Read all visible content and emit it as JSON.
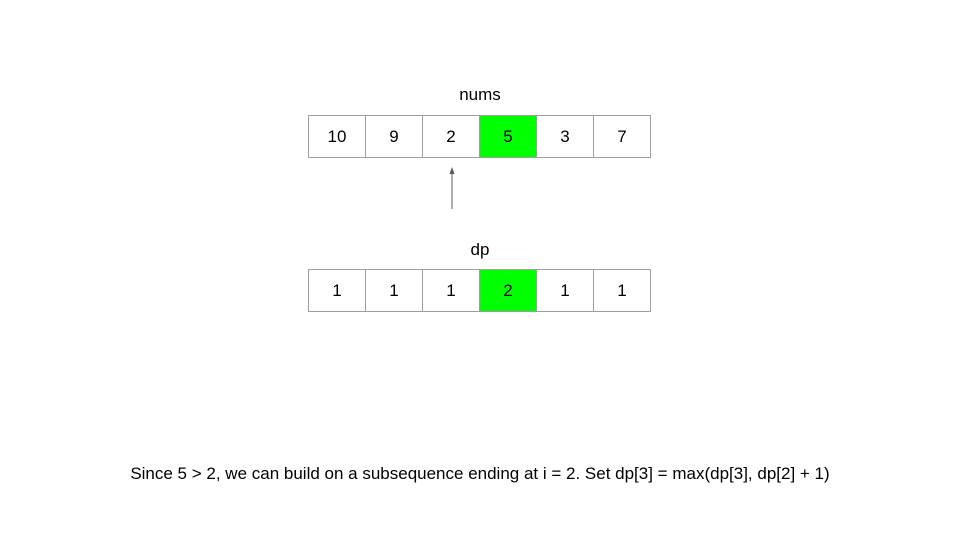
{
  "nums": {
    "title": "nums",
    "values": [
      "10",
      "9",
      "2",
      "5",
      "3",
      "7"
    ],
    "highlight_index": 3,
    "pointer_index": 2
  },
  "dp": {
    "title": "dp",
    "values": [
      "1",
      "1",
      "1",
      "2",
      "1",
      "1"
    ],
    "highlight_index": 3
  },
  "caption": "Since 5 > 2, we can build on a subsequence ending at i = 2. Set dp[3] = max(dp[3], dp[2] + 1)",
  "colors": {
    "highlight": "#00ff00",
    "cell_border": "#9e9e9e",
    "arrow": "#595959"
  }
}
